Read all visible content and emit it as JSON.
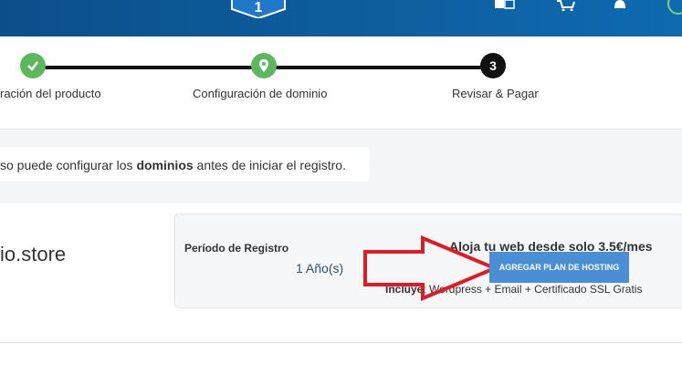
{
  "header": {
    "logo_number": "1",
    "icons": [
      "translate-icon",
      "cart-icon",
      "bell-icon"
    ]
  },
  "steps": [
    {
      "label": "ración del producto",
      "state": "done",
      "icon": "check-icon"
    },
    {
      "label": "Configuración de dominio",
      "state": "done",
      "icon": "location-pin-icon"
    },
    {
      "label": "Revisar & Pagar",
      "state": "current",
      "number": "3"
    }
  ],
  "notice": {
    "before": "so puede configurar los ",
    "bold": "dominios",
    "after": " antes de iniciar el registro."
  },
  "domain": {
    "name": "io.store"
  },
  "registration": {
    "label": "Período de Registro",
    "value": "1 Año(s)"
  },
  "hosting": {
    "title": "Aloja tu web desde solo 3.5€/mes",
    "button_label": "AGREGAR PLAN DE HOSTING",
    "includes_label": "Incluye",
    "includes_text": ": Wordpress + Email + Certificado SSL Gratis"
  },
  "colors": {
    "header": "#0f6ab0",
    "step_done": "#5cb85c",
    "step_current": "#111111",
    "button": "#4a8fd6",
    "arrow": "#e01b24"
  }
}
